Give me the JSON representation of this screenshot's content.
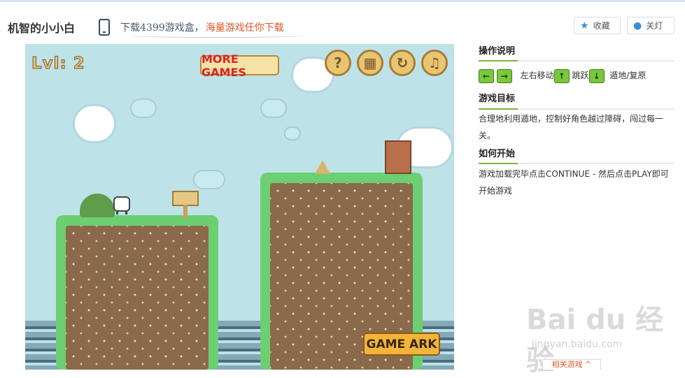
{
  "header": {
    "game_title": "机智的小小白",
    "promo_part1": "下载4399游戏盒，",
    "promo_part2": "海量游戏任你下载",
    "favorite_label": "收藏",
    "lights_off_label": "关灯",
    "favorite_icon": "star-icon",
    "lights_icon": "bulb-icon",
    "phone_icon": "phone-icon"
  },
  "game": {
    "level_label": "Lvl: 2",
    "more_games_label": "MORE GAMES",
    "help_label": "?",
    "levels_label": "▦",
    "restart_label": "↻",
    "music_label": "♫",
    "game_ark_label": "GAME ARK"
  },
  "sidebar": {
    "controls_title": "操作说明",
    "controls_move_label": "左右移动",
    "controls_jump_label": "跳跃",
    "controls_walk_label": "遁地/复原",
    "key_left": "←",
    "key_right": "→",
    "key_up": "↑",
    "key_down": "↓",
    "goal_title": "游戏目标",
    "goal_text": "合理地利用遁地，控制好角色越过障碍，闯过每一关。",
    "start_title": "如何开始",
    "start_text": "游戏加载完毕点击CONTINUE - 然后点击PLAY即可开始游戏"
  },
  "footer": {
    "related_label": "相关游戏 ^",
    "watermark_main": "Bai du 经验",
    "watermark_sub": "jingyan.baidu.com"
  },
  "colors": {
    "sky": "#bde3e8",
    "grass": "#6ccf72",
    "dirt": "#8a6a4a",
    "accent_green": "#7bb13c",
    "promo_orange": "#e0582a"
  }
}
